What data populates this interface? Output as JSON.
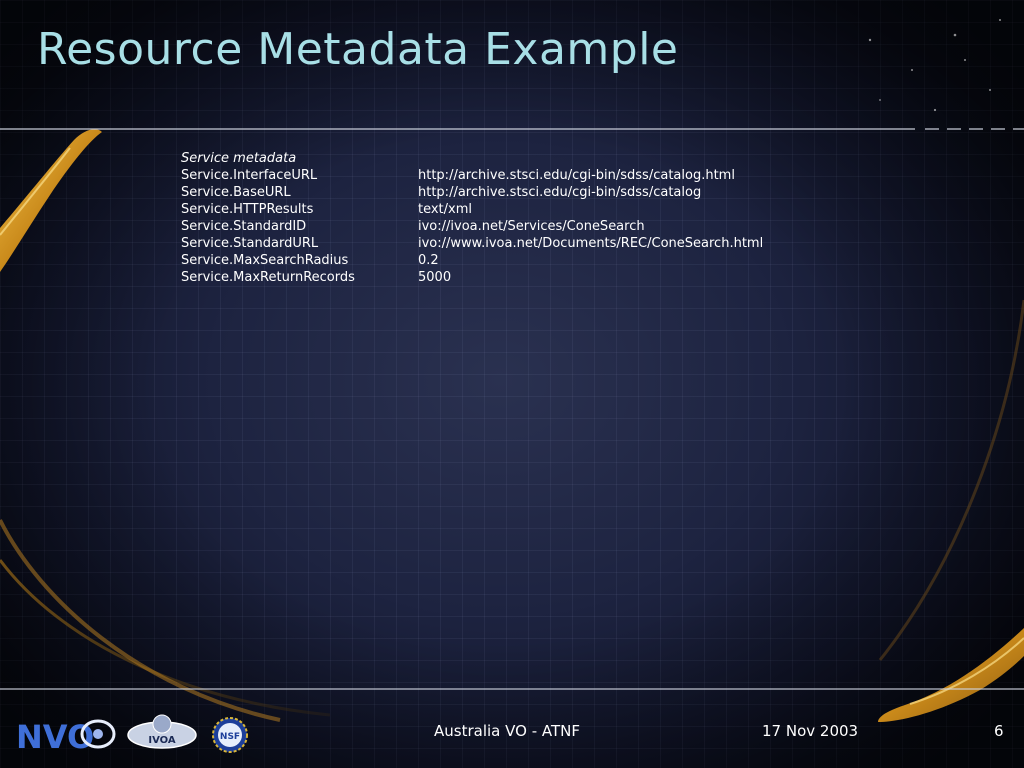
{
  "slide": {
    "title": "Resource Metadata Example",
    "section_heading": "Service metadata",
    "rows": [
      {
        "key": "Service.InterfaceURL",
        "value": "http://archive.stsci.edu/cgi-bin/sdss/catalog.html"
      },
      {
        "key": "Service.BaseURL",
        "value": "http://archive.stsci.edu/cgi-bin/sdss/catalog"
      },
      {
        "key": "Service.HTTPResults",
        "value": "text/xml"
      },
      {
        "key": "Service.StandardID",
        "value": "ivo://ivoa.net/Services/ConeSearch"
      },
      {
        "key": "Service.StandardURL",
        "value": "ivo://www.ivoa.net/Documents/REC/ConeSearch.html"
      },
      {
        "key": "Service.MaxSearchRadius",
        "value": "0.2"
      },
      {
        "key": "Service.MaxReturnRecords",
        "value": "5000"
      }
    ]
  },
  "footer": {
    "center_text": "Australia VO - ATNF",
    "date": "17 Nov 2003",
    "page_number": "6",
    "logos": {
      "nvo": "NVO",
      "ivoa": "IVOA",
      "nsf": "NSF"
    }
  },
  "colors": {
    "title": "#a8dfe6",
    "text": "#ffffff",
    "swoosh_gold": "#d9a12a",
    "background": "#1d2340"
  }
}
